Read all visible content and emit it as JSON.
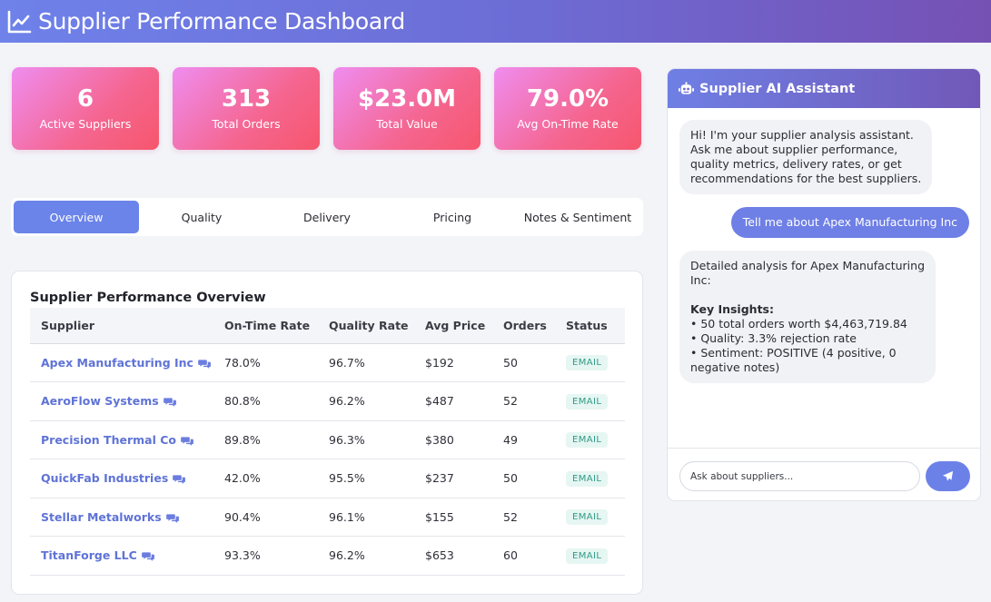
{
  "header": {
    "title": "Supplier Performance Dashboard",
    "icon": "line-chart-icon"
  },
  "stats": [
    {
      "value": "6",
      "label": "Active Suppliers"
    },
    {
      "value": "313",
      "label": "Total Orders"
    },
    {
      "value": "$23.0M",
      "label": "Total Value"
    },
    {
      "value": "79.0%",
      "label": "Avg On-Time Rate"
    }
  ],
  "tabs": [
    "Overview",
    "Quality",
    "Delivery",
    "Pricing",
    "Notes & Sentiment"
  ],
  "active_tab": "Overview",
  "table": {
    "title": "Supplier Performance Overview",
    "columns": [
      "Supplier",
      "On-Time Rate",
      "Quality Rate",
      "Avg Price",
      "Orders",
      "Status"
    ],
    "rows": [
      {
        "supplier": "Apex Manufacturing Inc",
        "on_time": "78.0%",
        "quality": "96.7%",
        "avg_price": "$192",
        "orders": "50",
        "status": "EMAIL"
      },
      {
        "supplier": "AeroFlow Systems",
        "on_time": "80.8%",
        "quality": "96.2%",
        "avg_price": "$487",
        "orders": "52",
        "status": "EMAIL"
      },
      {
        "supplier": "Precision Thermal Co",
        "on_time": "89.8%",
        "quality": "96.3%",
        "avg_price": "$380",
        "orders": "49",
        "status": "EMAIL"
      },
      {
        "supplier": "QuickFab Industries",
        "on_time": "42.0%",
        "quality": "95.5%",
        "avg_price": "$237",
        "orders": "50",
        "status": "EMAIL"
      },
      {
        "supplier": "Stellar Metalworks",
        "on_time": "90.4%",
        "quality": "96.1%",
        "avg_price": "$155",
        "orders": "52",
        "status": "EMAIL"
      },
      {
        "supplier": "TitanForge LLC",
        "on_time": "93.3%",
        "quality": "96.2%",
        "avg_price": "$653",
        "orders": "60",
        "status": "EMAIL"
      }
    ]
  },
  "chat": {
    "title": "Supplier AI Assistant",
    "icon": "robot-icon",
    "messages": {
      "welcome": [
        "Hi! I'm your supplier analysis assistant.",
        "Ask me about supplier performance,",
        "quality metrics, delivery rates, or get",
        "recommendations for the best suppliers."
      ],
      "user": "Tell me about Apex Manufacturing Inc",
      "reply_intro": [
        "Detailed analysis for Apex Manufacturing",
        "Inc:"
      ],
      "reply_heading": "Key Insights:",
      "reply_bullets": [
        "• 50 total orders worth $4,463,719.84",
        "• Quality: 3.3% rejection rate",
        "• Sentiment: POSITIVE (4 positive, 0",
        "negative notes)"
      ]
    },
    "input_placeholder": "Ask about suppliers...",
    "send_icon": "paper-plane-icon"
  },
  "colors": {
    "header_start": "#6e82ea",
    "header_end": "#7651b4",
    "card_start": "#ef8df0",
    "card_end": "#f6566d",
    "accent": "#6b84ea",
    "supplier_link": "#5f73d6",
    "badge_text": "#2f9a86",
    "badge_bg": "#e6f6f2"
  }
}
